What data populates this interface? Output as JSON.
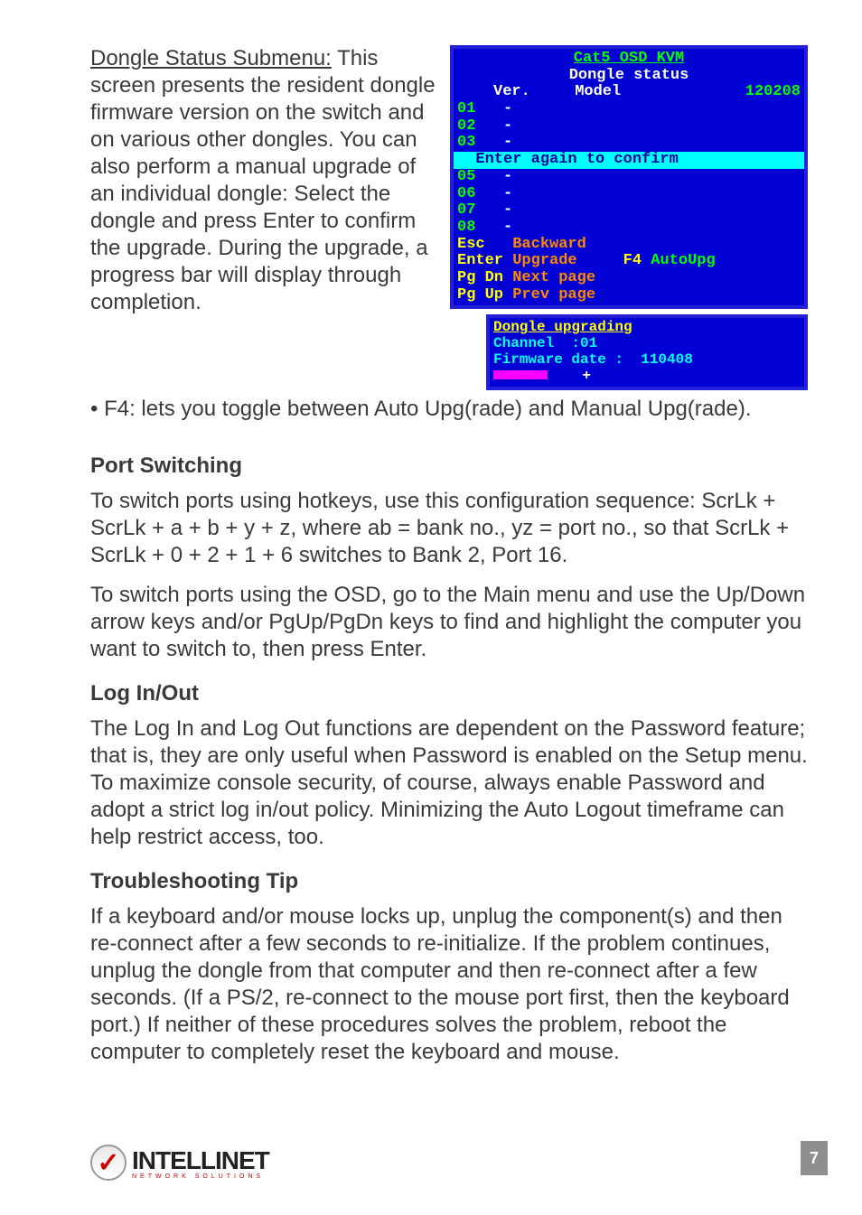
{
  "section": {
    "dongle_heading": "Dongle Status Submenu:",
    "dongle_para": "This screen presents the resident dongle firmware version on the switch and on various other dongles. You can also perform a manual upgrade of an individual dongle: Select the dongle and press Enter to confirm the upgrade. During the upgrade, a progress bar will display through completion.",
    "dongle_bullet": "•  F4: lets you toggle between Auto Upg(rade) and Manual Upg(rade).",
    "port_heading": "Port Switching",
    "port_p1": "To switch ports using hotkeys, use this configuration sequence: ScrLk + ScrLk + a + b + y + z, where ab = bank no., yz = port no., so that ScrLk + ScrLk + 0 + 2 + 1 + 6 switches to Bank 2, Port 16.",
    "port_p2": "To switch ports using the OSD, go to the Main menu and use the Up/Down arrow keys and/or PgUp/PgDn keys to find and highlight the computer you want to switch to, then press Enter.",
    "log_heading": "Log In/Out",
    "log_p1": "The Log In and Log Out functions are dependent on the Password feature; that is, they are only useful when Password is enabled on the Setup menu. To maximize console security, of course, always enable Password and adopt a strict log in/out policy. Minimizing the Auto Logout timeframe can help restrict access, too.",
    "troubleshoot_heading": "Troubleshooting Tip",
    "troubleshoot_p1": "If a keyboard and/or mouse locks up, unplug the component(s) and then re-connect after a few seconds to re-initialize. If the problem continues, unplug the dongle from that computer and then re-connect after a few seconds. (If a PS/2, re-connect to the mouse port first, then the keyboard port.) If neither of these procedures solves the problem, reboot the computer to completely reset the keyboard and mouse."
  },
  "osd1": {
    "title": "Cat5 OSD KVM",
    "subtitle": "Dongle status",
    "col_ver": "Ver.",
    "col_model": "Model",
    "date": "120208",
    "rows": {
      "r1": "01",
      "r2": "02",
      "r3": "03",
      "r5": "05",
      "r6": "06",
      "r7": "07",
      "r8": "08"
    },
    "confirm": "  Enter again to confirm",
    "dash": "-",
    "footer": {
      "k_esc": "Esc",
      "a_esc": "Backward",
      "k_ent": "Enter",
      "a_ent": "Upgrade",
      "k_f4": "F4",
      "a_f4": "AutoUpg",
      "k_pd": "Pg Dn",
      "a_pd": "Next page",
      "k_pu": "Pg Up",
      "a_pu": "Prev page"
    }
  },
  "osd2": {
    "title": "Dongle upgrading",
    "line1": "Channel  :01",
    "line2": "Firmware date :  110408",
    "cursor": "+"
  },
  "logo": {
    "brand": "INTELLINET",
    "tag": "NETWORK SOLUTIONS"
  },
  "page_number": "7"
}
